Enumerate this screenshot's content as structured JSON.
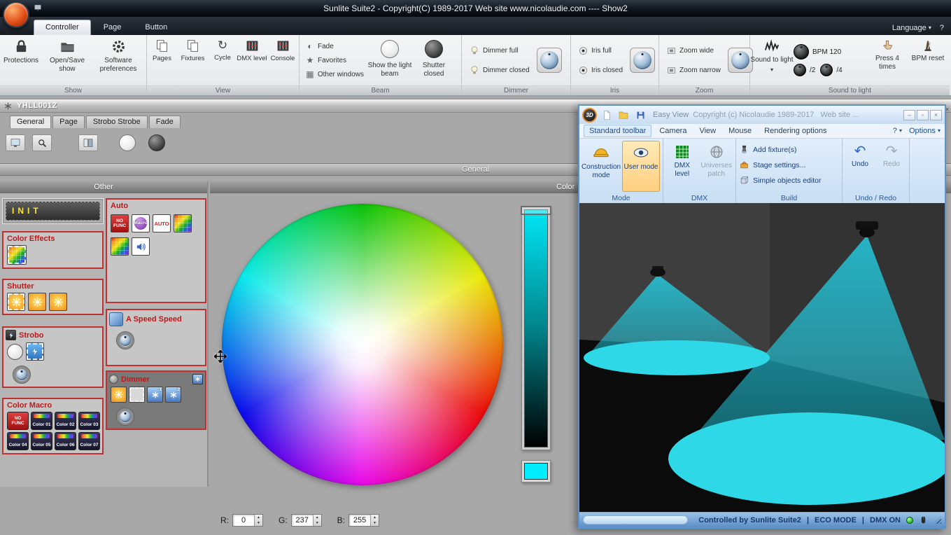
{
  "app": {
    "title": "Sunlite Suite2 - Copyright(C) 1989-2017    Web site www.nicolaudie.com ---- Show2",
    "workspace_close": "×"
  },
  "ribbon": {
    "tabs": [
      {
        "label": "Controller"
      },
      {
        "label": "Page"
      },
      {
        "label": "Button"
      }
    ],
    "language": "Language",
    "help": "?",
    "icons": {
      "cycle": "↻",
      "fade": "◐",
      "favorites": "★",
      "other_windows": "▦",
      "caret": "▾"
    },
    "groups": {
      "show": {
        "label": "Show",
        "items": [
          {
            "label": "Protections"
          },
          {
            "label": "Open/Save show"
          },
          {
            "label": "Software preferences"
          }
        ]
      },
      "view": {
        "label": "View",
        "items": [
          {
            "label": "Pages"
          },
          {
            "label": "Fixtures"
          },
          {
            "label": "Cycle"
          },
          {
            "label": "DMX level"
          },
          {
            "label": "Console"
          }
        ]
      },
      "beam": {
        "label": "Beam",
        "small_items": [
          {
            "label": "Fade"
          },
          {
            "label": "Favorites"
          },
          {
            "label": "Other windows"
          }
        ],
        "big_items": [
          {
            "label": "Show the light beam"
          },
          {
            "label": "Shutter closed"
          }
        ]
      },
      "dimmer": {
        "label": "Dimmer",
        "items": [
          {
            "label": "Dimmer full"
          },
          {
            "label": "Dimmer closed"
          }
        ]
      },
      "iris": {
        "label": "Iris",
        "items": [
          {
            "label": "Iris full"
          },
          {
            "label": "Iris closed"
          }
        ]
      },
      "zoom": {
        "label": "Zoom",
        "items": [
          {
            "label": "Zoom wide"
          },
          {
            "label": "Zoom narrow"
          }
        ]
      },
      "sound": {
        "label": "Sound to light",
        "button": "Sound to light",
        "bpm": "BPM 120",
        "div2": "/2",
        "div4": "/4",
        "press": "Press 4 times",
        "reset": "BPM reset"
      }
    }
  },
  "button_window": {
    "title": "YHLL001Z",
    "tabs": [
      {
        "label": "General"
      },
      {
        "label": "Page"
      },
      {
        "label": "Strobo Strobe"
      },
      {
        "label": "Fade"
      }
    ],
    "general_header": "General",
    "color_header": "Color",
    "other_panel": {
      "title": "Other",
      "init_label": "INIT",
      "color_effects_title": "Color Effects",
      "shutter_title": "Shutter",
      "strobo_title": "Strobo",
      "color_macro_title": "Color Macro",
      "color_macro_tiles": [
        "NO FUNC",
        "Color 01",
        "Color 02",
        "Color 03",
        "Color 04",
        "Color 05",
        "Color 06",
        "Color 07"
      ],
      "auto_title": "Auto",
      "auto_no_func": "NO FUNC",
      "auto_macro": "Macro",
      "auto_auto": "AUTO",
      "speed_title": "A Speed Speed",
      "dimmer_title": "Dimmer",
      "dimmer_badges": [
        "1",
        "2"
      ]
    },
    "rgb": {
      "r_label": "R:",
      "r_value": "0",
      "g_label": "G:",
      "g_value": "237",
      "b_label": "B:",
      "b_value": "255",
      "up": "▲",
      "down": "▼"
    }
  },
  "easy_view": {
    "title": "Easy View",
    "copyright": "Copyright (c) Nicolaudie 1989-2017",
    "website": "Web site ...",
    "tabs": [
      {
        "label": "Standard toolbar"
      },
      {
        "label": "Camera"
      },
      {
        "label": "View"
      },
      {
        "label": "Mouse"
      },
      {
        "label": "Rendering options"
      }
    ],
    "help": "?",
    "options": "Options",
    "glyphs": {
      "undo": "↶",
      "redo": "↷",
      "min": "–",
      "max": "▫",
      "close": "×",
      "caret": "▾"
    },
    "toolbar": {
      "mode_label": "Mode",
      "construction": "Construction mode",
      "user": "User mode",
      "dmx_label": "DMX",
      "dmx_level": "DMX level",
      "universes": "Universes patch",
      "build_label": "Build",
      "build_items": [
        {
          "label": "Add fixture(s)"
        },
        {
          "label": "Stage settings..."
        },
        {
          "label": "Simple objects editor"
        }
      ],
      "undo_label": "Undo / Redo",
      "undo": "Undo",
      "redo": "Redo"
    },
    "statusbar": {
      "controlled": "Controlled by Sunlite Suite2",
      "sep": "|",
      "eco": "ECO MODE",
      "dmx": "DMX ON"
    }
  },
  "colors": {
    "accent_cyan": "#00EDFF",
    "beam": "#22d8ee",
    "pool": "#2ed8e6",
    "section_border": "#c03030",
    "selected_mode_bg": "#ffd080"
  }
}
